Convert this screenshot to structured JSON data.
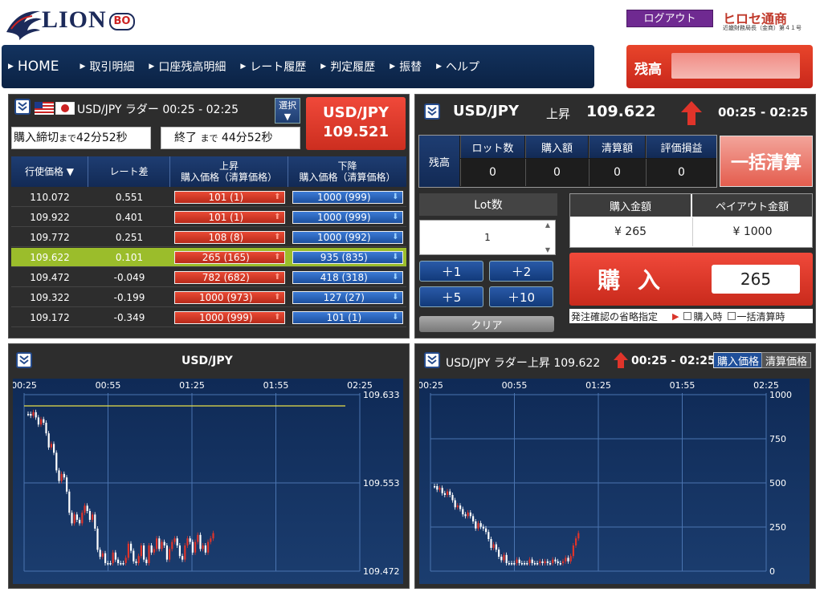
{
  "header": {
    "logo_text": "LION",
    "logo_badge": "BO",
    "logout_label": "ログアウト",
    "broker_name": "ヒロセ通商",
    "broker_sub": "近畿財務局長（金商）第４１号",
    "balance_label": "残高"
  },
  "nav": [
    {
      "label": "HOME"
    },
    {
      "label": "取引明細"
    },
    {
      "label": "口座残高明細"
    },
    {
      "label": "レート履歴"
    },
    {
      "label": "判定履歴"
    },
    {
      "label": "振替"
    },
    {
      "label": "ヘルプ"
    }
  ],
  "ladder": {
    "title": "USD/JPY ラダー 00:25 - 02:25",
    "select_label": "選択",
    "pair": "USD/JPY",
    "rate": "109.521",
    "countdown1_main": "購入締切",
    "countdown1_small": "まで",
    "countdown1_value": "42分52秒",
    "countdown2_main": "終了",
    "countdown2_small": "まで",
    "countdown2_value": "44分52秒",
    "col_strike": "行使価格 ▼",
    "col_diff": "レート差",
    "col_up_top": "上昇",
    "col_up_bottom": "購入価格（清算価格）",
    "col_down_top": "下降",
    "col_down_bottom": "購入価格（清算価格）",
    "rows": [
      {
        "strike": "110.072",
        "diff": "0.551",
        "up": "101 (1)",
        "down": "1000 (999)"
      },
      {
        "strike": "109.922",
        "diff": "0.401",
        "up": "101 (1)",
        "down": "1000 (999)"
      },
      {
        "strike": "109.772",
        "diff": "0.251",
        "up": "108 (8)",
        "down": "1000 (992)"
      },
      {
        "strike": "109.622",
        "diff": "0.101",
        "up": "265 (165)",
        "down": "935 (835)"
      },
      {
        "strike": "109.472",
        "diff": "-0.049",
        "up": "782 (682)",
        "down": "418 (318)"
      },
      {
        "strike": "109.322",
        "diff": "-0.199",
        "up": "1000 (973)",
        "down": "127 (27)"
      },
      {
        "strike": "109.172",
        "diff": "-0.349",
        "up": "1000 (999)",
        "down": "101 (1)"
      }
    ],
    "highlight_row": 3
  },
  "order": {
    "pair": "USD/JPY",
    "direction": "上昇",
    "rate": "109.622",
    "time": "00:25 - 02:25",
    "summary_label": "残高",
    "summary_headers": [
      "ロット数",
      "購入額",
      "清算額",
      "評価損益"
    ],
    "summary_values": [
      "0",
      "0",
      "0",
      "0"
    ],
    "settle_all": "一括清算",
    "lot_label": "Lot数",
    "lot_value": "1",
    "steps": [
      "＋1",
      "＋2",
      "＋5",
      "＋10"
    ],
    "clear_label": "クリア",
    "purchase_amount_label": "購入金額",
    "payout_label": "ペイアウト金額",
    "purchase_amount": "¥ 265",
    "payout_amount": "¥ 1000",
    "buy_label": "購入",
    "buy_amount": "265",
    "confirm_text": "発注確認の省略指定",
    "confirm_opt1": "購入時",
    "confirm_opt2": "一括清算時"
  },
  "chart1": {
    "title": "USD/JPY",
    "x_ticks": [
      "00:25",
      "00:55",
      "01:25",
      "01:55",
      "02:25"
    ],
    "y_ticks": [
      "109.633",
      "109.553",
      "109.472"
    ]
  },
  "chart2": {
    "title": "USD/JPY ラダー上昇 109.622",
    "time": "00:25 - 02:25",
    "btn_buy": "購入価格",
    "btn_settle": "清算価格",
    "x_ticks": [
      "00:25",
      "00:55",
      "01:25",
      "01:55",
      "02:25"
    ],
    "y_ticks": [
      "1000",
      "750",
      "500",
      "250",
      "0"
    ]
  },
  "colors": {
    "up": "#d9342a",
    "down": "#2a62c0",
    "highlight": "#9bbd2b",
    "panel": "#2d2d2d",
    "navy": "#13335f"
  }
}
